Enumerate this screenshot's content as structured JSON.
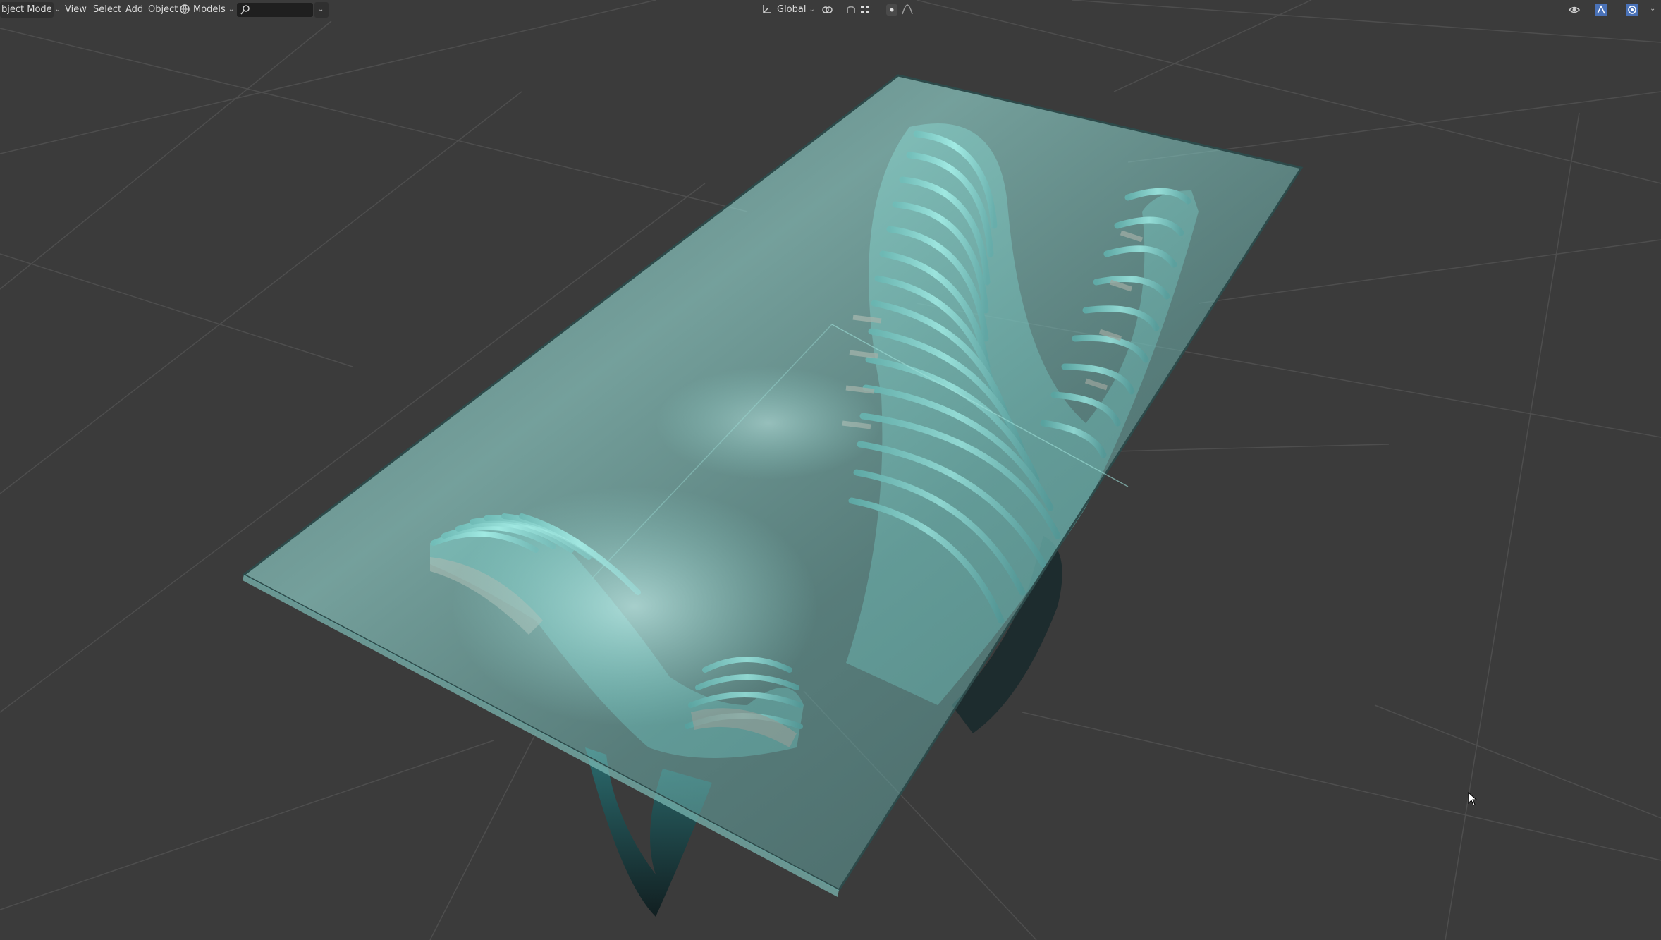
{
  "header": {
    "mode_label": "bject Mode",
    "menu": {
      "view": "View",
      "select": "Select",
      "add": "Add",
      "object": "Object"
    },
    "collection_label": "Models",
    "search_value": "",
    "transform_orientation": "Global"
  },
  "icons": [
    "chevron-down-icon",
    "globe-icon",
    "search-icon",
    "filter-icon",
    "transform-orientation-icon",
    "pivot-point-icon",
    "snap-icon",
    "snap-target-icon",
    "proportional-editing-icon",
    "proportional-falloff-icon",
    "visibility-icon",
    "gizmo-icon",
    "overlay-icon"
  ],
  "colors": {
    "viewport_background": "#3b3b3b",
    "grid_line": "#4d4d4d",
    "glass": "#8fd6cf",
    "slat_highlight": "#a8f2ec",
    "slat_side": "#b07d74",
    "active_icon": "#4a72b8"
  }
}
